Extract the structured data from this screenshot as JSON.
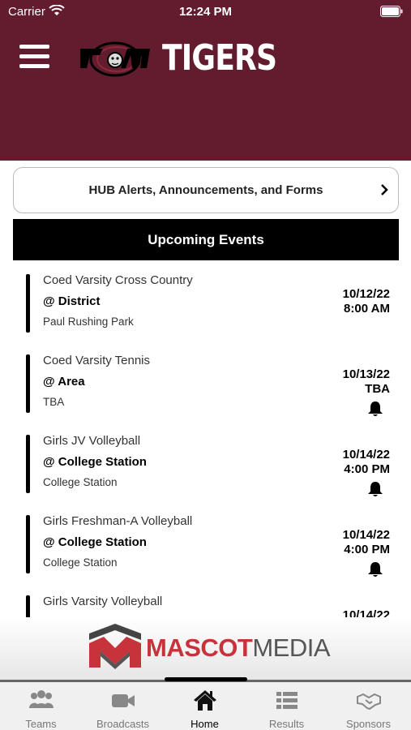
{
  "status_bar": {
    "carrier": "Carrier",
    "time": "12:24 PM"
  },
  "header": {
    "team_name": "TIGERS",
    "logo_icon": "school-logo-icon",
    "menu_icon": "hamburger-menu-icon"
  },
  "hub": {
    "label": "HUB Alerts, Announcements, and Forms",
    "chevron_icon": "chevron-right-icon"
  },
  "events_section": {
    "title": "Upcoming Events"
  },
  "events": [
    {
      "name": "Coed Varsity Cross Country",
      "opponent": "@ District",
      "location": "Paul Rushing Park",
      "date": "10/12/22",
      "time": "8:00 AM",
      "bell": false
    },
    {
      "name": "Coed Varsity Tennis",
      "opponent": "@ Area",
      "location": "TBA",
      "date": "10/13/22",
      "time": "TBA",
      "bell": true
    },
    {
      "name": "Girls JV Volleyball",
      "opponent": "@ College Station",
      "location": "College Station",
      "date": "10/14/22",
      "time": "4:00 PM",
      "bell": true
    },
    {
      "name": "Girls Freshman-A Volleyball",
      "opponent": "@ College Station",
      "location": "College Station",
      "date": "10/14/22",
      "time": "4:00 PM",
      "bell": true
    },
    {
      "name": "Girls Varsity Volleyball",
      "opponent": "",
      "location": "",
      "date": "10/14/22",
      "time": "",
      "bell": false
    }
  ],
  "sponsor": {
    "brand_part1": "MASCOT",
    "brand_part2": "MEDIA",
    "logo_icon": "mascot-media-logo-icon"
  },
  "tabs": [
    {
      "label": "Teams",
      "icon": "teams-icon"
    },
    {
      "label": "Broadcasts",
      "icon": "video-camera-icon"
    },
    {
      "label": "Home",
      "icon": "home-icon",
      "active": true
    },
    {
      "label": "Results",
      "icon": "list-icon"
    },
    {
      "label": "Sponsors",
      "icon": "handshake-icon"
    }
  ],
  "colors": {
    "header_bg": "#631b2e",
    "accent_red": "#c8323a"
  }
}
